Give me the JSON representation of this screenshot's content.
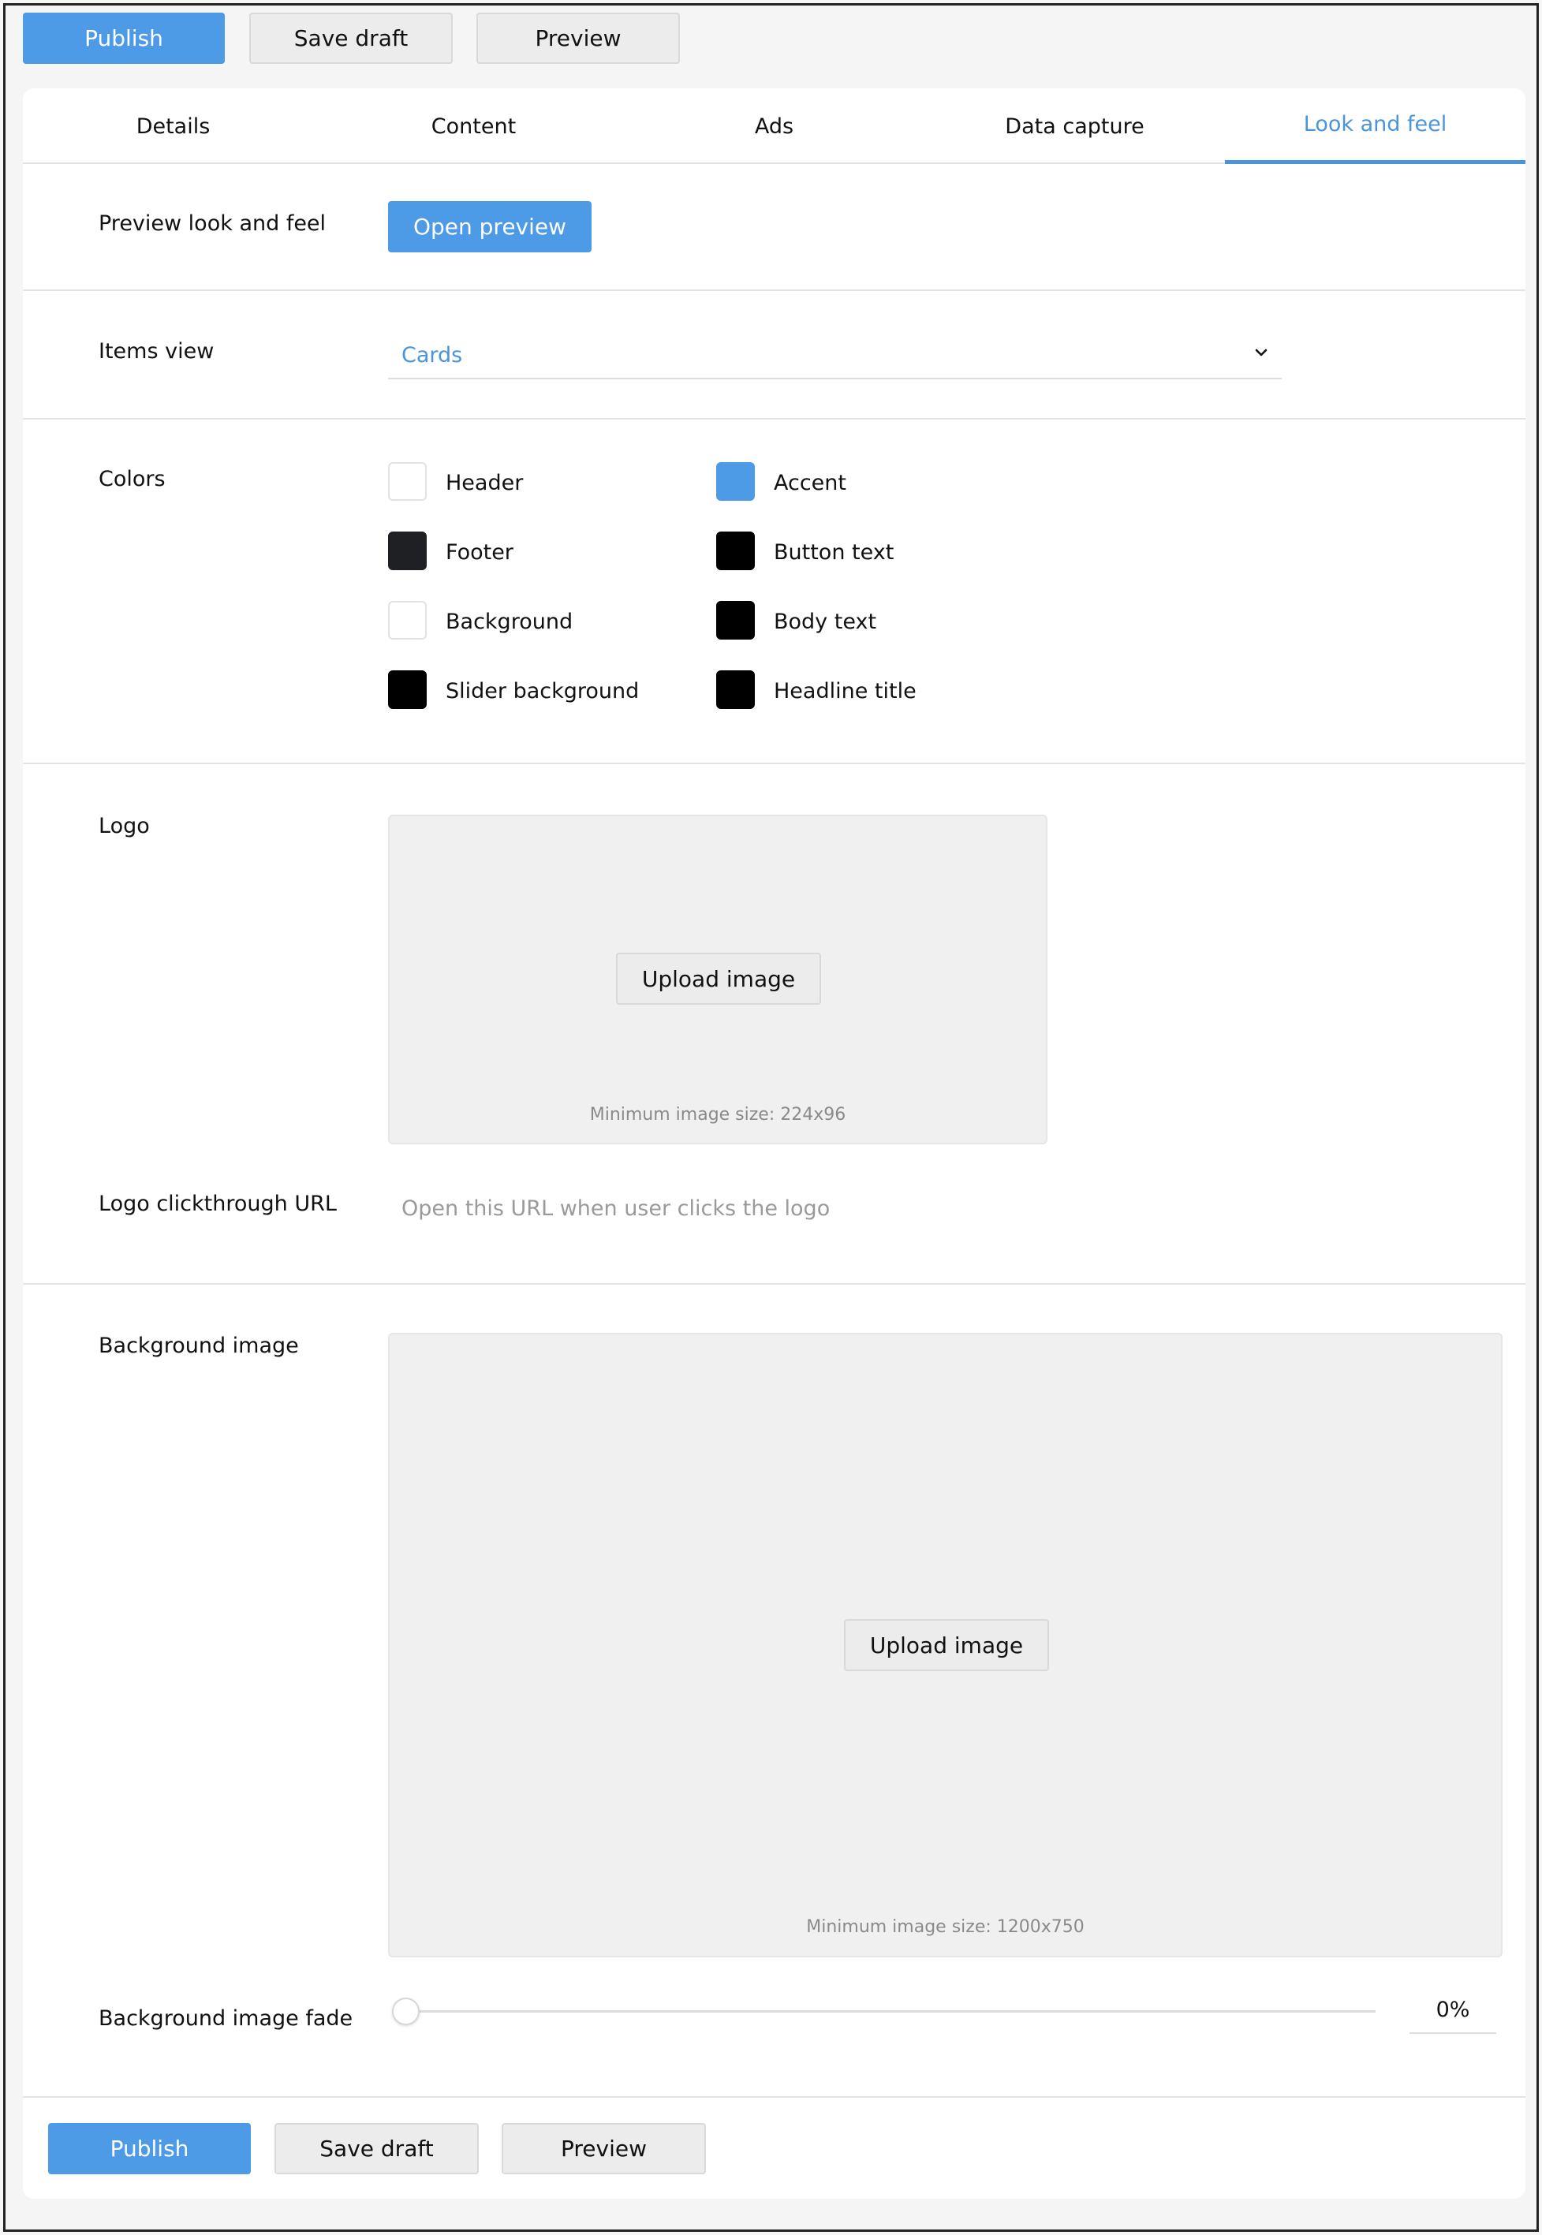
{
  "toolbar": {
    "publish_label": "Publish",
    "save_draft_label": "Save draft",
    "preview_label": "Preview"
  },
  "tabs": [
    {
      "label": "Details",
      "active": false
    },
    {
      "label": "Content",
      "active": false
    },
    {
      "label": "Ads",
      "active": false
    },
    {
      "label": "Data capture",
      "active": false
    },
    {
      "label": "Look and feel",
      "active": true
    }
  ],
  "preview_section": {
    "label": "Preview look and feel",
    "button_label": "Open preview"
  },
  "items_view": {
    "label": "Items view",
    "selected": "Cards"
  },
  "colors": {
    "label": "Colors",
    "items": [
      {
        "name": "Header",
        "color": "#ffffff"
      },
      {
        "name": "Accent",
        "color": "#4d9be6"
      },
      {
        "name": "Footer",
        "color": "#1e2023"
      },
      {
        "name": "Button text",
        "color": "#000000"
      },
      {
        "name": "Background",
        "color": "#ffffff"
      },
      {
        "name": "Body text",
        "color": "#000000"
      },
      {
        "name": "Slider background",
        "color": "#000000"
      },
      {
        "name": "Headline title",
        "color": "#000000"
      }
    ]
  },
  "logo": {
    "label": "Logo",
    "upload_label": "Upload image",
    "hint": "Minimum image size: 224x96"
  },
  "logo_url": {
    "label": "Logo clickthrough URL",
    "placeholder": "Open this URL when user clicks the logo",
    "value": ""
  },
  "background_image": {
    "label": "Background image",
    "upload_label": "Upload image",
    "hint": "Minimum image size: 1200x750"
  },
  "background_fade": {
    "label": "Background image fade",
    "value_text": "0%",
    "value_fraction": 0
  },
  "theme": {
    "accent": "#4a94dd",
    "primary_button": "#4d9be6"
  }
}
